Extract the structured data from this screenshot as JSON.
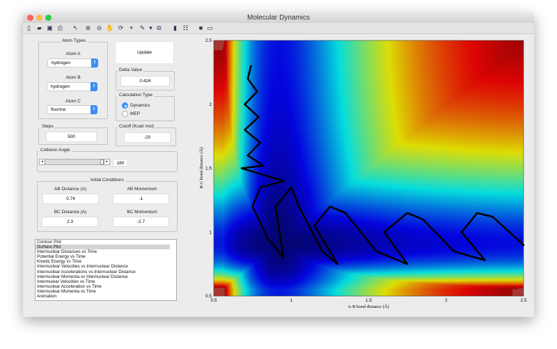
{
  "window": {
    "title": "Molecular Dynamics"
  },
  "toolbar": {
    "icons": [
      "new-file-icon",
      "open-folder-icon",
      "save-icon",
      "print-icon",
      "pointer-icon",
      "zoom-in-icon",
      "zoom-out-icon",
      "pan-icon",
      "rotate-icon",
      "data-cursor-icon",
      "brush-icon",
      "dropdown-arrow-icon",
      "link-plot-icon",
      "colorbar-icon",
      "legend-icon",
      "hide-plot-tools-icon",
      "show-plot-tools-icon"
    ]
  },
  "atom_types": {
    "title": "Atom Types",
    "atom_a_label": "Atom A",
    "atom_a": "hydrogen",
    "atom_b_label": "Atom B",
    "atom_b": "hydrogen",
    "atom_c_label": "Atom C",
    "atom_c": "fluorine"
  },
  "update_label": "Update",
  "delta": {
    "title": "Delta Value",
    "value": "0.424"
  },
  "calc_type": {
    "title": "Calculation Type",
    "options": [
      "Dynamics",
      "MEP"
    ],
    "selected": "Dynamics"
  },
  "steps": {
    "title": "Steps",
    "value": "500"
  },
  "cutoff": {
    "title": "Cutoff (Kcal/ mol)",
    "value": "-20"
  },
  "collision": {
    "title": "Collision Angle",
    "value": "180",
    "slider_fraction": 1.0
  },
  "initial": {
    "title": "Initial Conditions",
    "ab_dist_label": "AB Distance (A)",
    "ab_dist": "0.74",
    "ab_mom_label": "AB Momentum",
    "ab_mom": "-1",
    "bc_dist_label": "BC Distance (A)",
    "bc_dist": "2.3",
    "bc_mom_label": "BC Momentum",
    "bc_mom": "-2.7"
  },
  "plot_list": {
    "items": [
      "Contour Plot",
      "Surface Plot",
      "Internuclear Distances vs Time",
      "Potential Energy vs Time",
      "Kinetic Energy vs Time",
      "Internuclear Velocities vs Internuclear Distance",
      "Internuclear Accelerations vs Internuclear Distance",
      "Internuclear Momenta vs Internuclear Distance",
      "Intermuiear Velocities vs Time",
      "Internuclear Acceleration vs Time",
      "Internuclear Momenta vs Time",
      "Animation"
    ],
    "selected": "Surface Plot"
  },
  "chart_data": {
    "type": "heatmap",
    "xlabel": "A-B bond distance (Å)",
    "ylabel": "B-C bond distance (Å)",
    "xlim": [
      0.5,
      2.5
    ],
    "ylim": [
      0.5,
      2.5
    ],
    "xticks": [
      "0.5",
      "1",
      "1.5",
      "2",
      "2.5"
    ],
    "yticks": [
      "0.5",
      "1",
      "1.5",
      "2",
      "2.5"
    ],
    "trajectory": [
      [
        0.74,
        2.3
      ],
      [
        0.72,
        2.2
      ],
      [
        0.78,
        2.1
      ],
      [
        0.7,
        2.0
      ],
      [
        0.79,
        1.9
      ],
      [
        0.7,
        1.8
      ],
      [
        0.8,
        1.7
      ],
      [
        0.72,
        1.6
      ],
      [
        0.82,
        1.52
      ],
      [
        0.68,
        1.5
      ],
      [
        0.95,
        1.4
      ],
      [
        0.8,
        1.35
      ],
      [
        0.75,
        1.2
      ],
      [
        0.85,
        0.95
      ],
      [
        0.95,
        0.8
      ],
      [
        0.9,
        1.2
      ],
      [
        1.0,
        1.35
      ],
      [
        1.05,
        1.2
      ],
      [
        1.2,
        0.85
      ],
      [
        1.3,
        0.75
      ],
      [
        1.15,
        1.05
      ],
      [
        1.25,
        1.2
      ],
      [
        1.35,
        1.15
      ],
      [
        1.55,
        0.85
      ],
      [
        1.75,
        0.75
      ],
      [
        1.6,
        1.0
      ],
      [
        1.75,
        1.15
      ],
      [
        1.85,
        1.1
      ],
      [
        2.05,
        0.85
      ],
      [
        2.25,
        0.78
      ],
      [
        2.1,
        1.0
      ],
      [
        2.2,
        1.15
      ],
      [
        2.3,
        1.12
      ],
      [
        2.5,
        0.9
      ]
    ]
  }
}
